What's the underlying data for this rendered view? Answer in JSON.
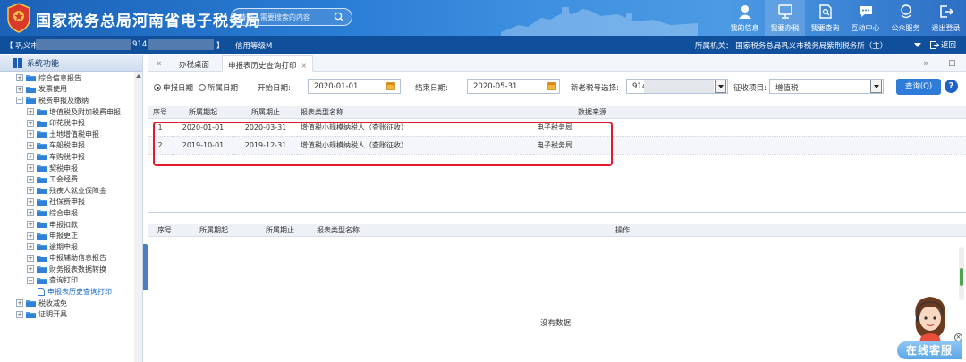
{
  "header": {
    "title": "国家税务总局河南省电子税务局",
    "search_placeholder": "请输入需要搜索的内容",
    "nav": [
      {
        "label": "我的信息",
        "icon": "user-icon"
      },
      {
        "label": "我要办税",
        "icon": "monitor-icon"
      },
      {
        "label": "我要查询",
        "icon": "query-icon"
      },
      {
        "label": "互动中心",
        "icon": "chat-icon"
      },
      {
        "label": "公众服务",
        "icon": "service-icon"
      },
      {
        "label": "退出登录",
        "icon": "logout-icon"
      }
    ]
  },
  "infobar": {
    "location": "【 巩义市",
    "taxpayer_id_prefix": "914",
    "bracket_close": "】",
    "credit_level": "信用等级M",
    "authority": "所属机关：  国家税务总局巩义市税务局紫荆税务所（主）",
    "back_label": "返回"
  },
  "sidebar": {
    "title": "系统功能",
    "tree": [
      {
        "label": "综合信息报告",
        "level": 0,
        "exp": "+"
      },
      {
        "label": "发票使用",
        "level": 0,
        "exp": "+"
      },
      {
        "label": "税费申报及缴纳",
        "level": 0,
        "exp": "−"
      },
      {
        "label": "增值税及附加税费申报",
        "level": 1,
        "exp": "+"
      },
      {
        "label": "印花税申报",
        "level": 1,
        "exp": "+"
      },
      {
        "label": "土地增值税申报",
        "level": 1,
        "exp": "+"
      },
      {
        "label": "车船税申报",
        "level": 1,
        "exp": "+"
      },
      {
        "label": "车购税申报",
        "level": 1,
        "exp": "+"
      },
      {
        "label": "契税申报",
        "level": 1,
        "exp": "+"
      },
      {
        "label": "工会经费",
        "level": 1,
        "exp": "+"
      },
      {
        "label": "残疾人就业保障金",
        "level": 1,
        "exp": "+"
      },
      {
        "label": "社保费申报",
        "level": 1,
        "exp": "+"
      },
      {
        "label": "综合申报",
        "level": 1,
        "exp": "+"
      },
      {
        "label": "申报扣款",
        "level": 1,
        "exp": "+"
      },
      {
        "label": "申报更正",
        "level": 1,
        "exp": "+"
      },
      {
        "label": "逾期申报",
        "level": 1,
        "exp": "+"
      },
      {
        "label": "申报辅助信息报告",
        "level": 1,
        "exp": "+"
      },
      {
        "label": "财务报表数据转换",
        "level": 1,
        "exp": "+"
      },
      {
        "label": "查询打印",
        "level": 1,
        "exp": "−"
      },
      {
        "label": "申报表历史查询打印",
        "level": 2,
        "exp": "",
        "selected": true
      },
      {
        "label": "税收减免",
        "level": 0,
        "exp": "+"
      },
      {
        "label": "证明开具",
        "level": 0,
        "exp": "+"
      }
    ]
  },
  "tabs": {
    "items": [
      {
        "label": "办税桌面"
      },
      {
        "label": "申报表历史查询打印",
        "closable": true
      }
    ],
    "close_char": "×"
  },
  "filters": {
    "radio_declare": "申报日期",
    "radio_period": "所属日期",
    "start_label": "开始日期:",
    "start_value": "2020-01-01",
    "end_label": "结束日期:",
    "end_value": "2020-05-31",
    "taxid_label": "新老税号选择:",
    "taxid_value": "914",
    "levy_label": "征收项目:",
    "levy_value": "增值税",
    "query_label": "查询(Q)",
    "help_label": "?"
  },
  "upper_table": {
    "headers": [
      "序号",
      "所属期起",
      "所属期止",
      "报表类型名称",
      "数据来源"
    ],
    "rows": [
      [
        "1",
        "2020-01-01",
        "2020-03-31",
        "增值税小规模纳税人（查账征收）",
        "电子税务局"
      ],
      [
        "2",
        "2019-10-01",
        "2019-12-31",
        "增值税小规模纳税人（查账征收）",
        "电子税务局"
      ]
    ]
  },
  "lower_table": {
    "headers": [
      "序号",
      "所属期起",
      "所属期止",
      "报表类型名称",
      "操作"
    ],
    "empty_text": "没有数据"
  },
  "customer_service": {
    "label": "在线客服",
    "close": "×"
  },
  "colors": {
    "header_blue": "#2a7dd4",
    "infobar_blue": "#0f4f9c",
    "highlight_red": "#e21b2c",
    "query_button": "#2f7bd8"
  }
}
